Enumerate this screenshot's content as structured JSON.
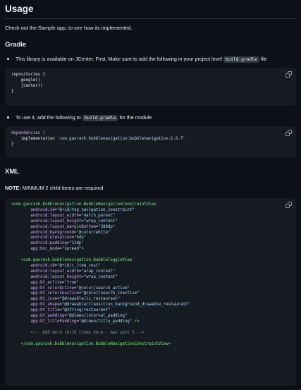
{
  "usage": {
    "title": "Usage",
    "intro": "Check out the Sample app, to see how its implemented."
  },
  "gradle": {
    "title": "Gradle",
    "bullet1_before": "This library is available on JCenter. First, Make sure to add the following in your project level",
    "bullet1_code": "build.gradle",
    "bullet1_after": "file",
    "repo_block": {
      "line1": "repositories {",
      "line2": "    google()",
      "line3": "    jcenter()",
      "line4": "}"
    },
    "bullet2_before": "To use it, add the following to",
    "bullet2_code": "build.gradle",
    "bullet2_after": "for the module",
    "deps_block": {
      "line1_kw": "dependencies {",
      "line2_plain": "    implementation ",
      "line2_str": "'com.gauravk.bubblenavigation:bubblenavigation:1.0.7'",
      "line3": "}"
    }
  },
  "xml": {
    "title": "XML",
    "note_label": "NOTE:",
    "note_text": " MINMUM 2 child items are required",
    "code": {
      "open_outer": "<com.gauravk.bubblenavigation.BubbleNavigationConstraintView",
      "outer_attrs": [
        {
          "name": "android:id",
          "value": "\"@+id/top_navigation_constraint\""
        },
        {
          "name": "android:layout_width",
          "value": "\"match_parent\""
        },
        {
          "name": "android:layout_height",
          "value": "\"wrap_content\""
        },
        {
          "name": "android:layout_marginBottom",
          "value": "\"380dp\""
        },
        {
          "name": "android:background",
          "value": "\"@color/white\""
        },
        {
          "name": "android:elevation",
          "value": "\"4dp\""
        },
        {
          "name": "android:padding",
          "value": "\"12dp\""
        },
        {
          "name": "app:bnc_mode",
          "value": "\"spread\"",
          "suffix": ">"
        }
      ],
      "open_inner": "<com.gauravk.bubblenavigation.BubbleToggleView",
      "inner_attrs": [
        {
          "name": "android:id",
          "value": "\"@+id/c_item_rest\""
        },
        {
          "name": "android:layout_width",
          "value": "\"wrap_content\""
        },
        {
          "name": "android:layout_height",
          "value": "\"wrap_content\""
        },
        {
          "name": "app:bt_active",
          "value": "\"true\""
        },
        {
          "name": "app:bt_colorActive",
          "value": "\"@color/search_active\""
        },
        {
          "name": "app:bt_colorInactive",
          "value": "\"@color/search_inactive\""
        },
        {
          "name": "app:bt_icon",
          "value": "\"@drawable/ic_restaurant\""
        },
        {
          "name": "app:bt_shape",
          "value": "\"@drawable/transition_background_drawable_restaurant\""
        },
        {
          "name": "app:bt_title",
          "value": "\"@string/restaurant\""
        },
        {
          "name": "app:bt_padding",
          "value": "\"@dimen/internal_padding\""
        },
        {
          "name": "app:bt_titlePadding",
          "value": "\"@dimen/title_padding\"",
          "suffix": " />"
        }
      ],
      "comment": "<!-- Add more child items here - max upto 5 -->",
      "close_outer": "</com.gauravk.bubblenavigation.BubbleNavigationConstraintView>"
    }
  },
  "icons": {
    "copy": "copy-icon"
  }
}
